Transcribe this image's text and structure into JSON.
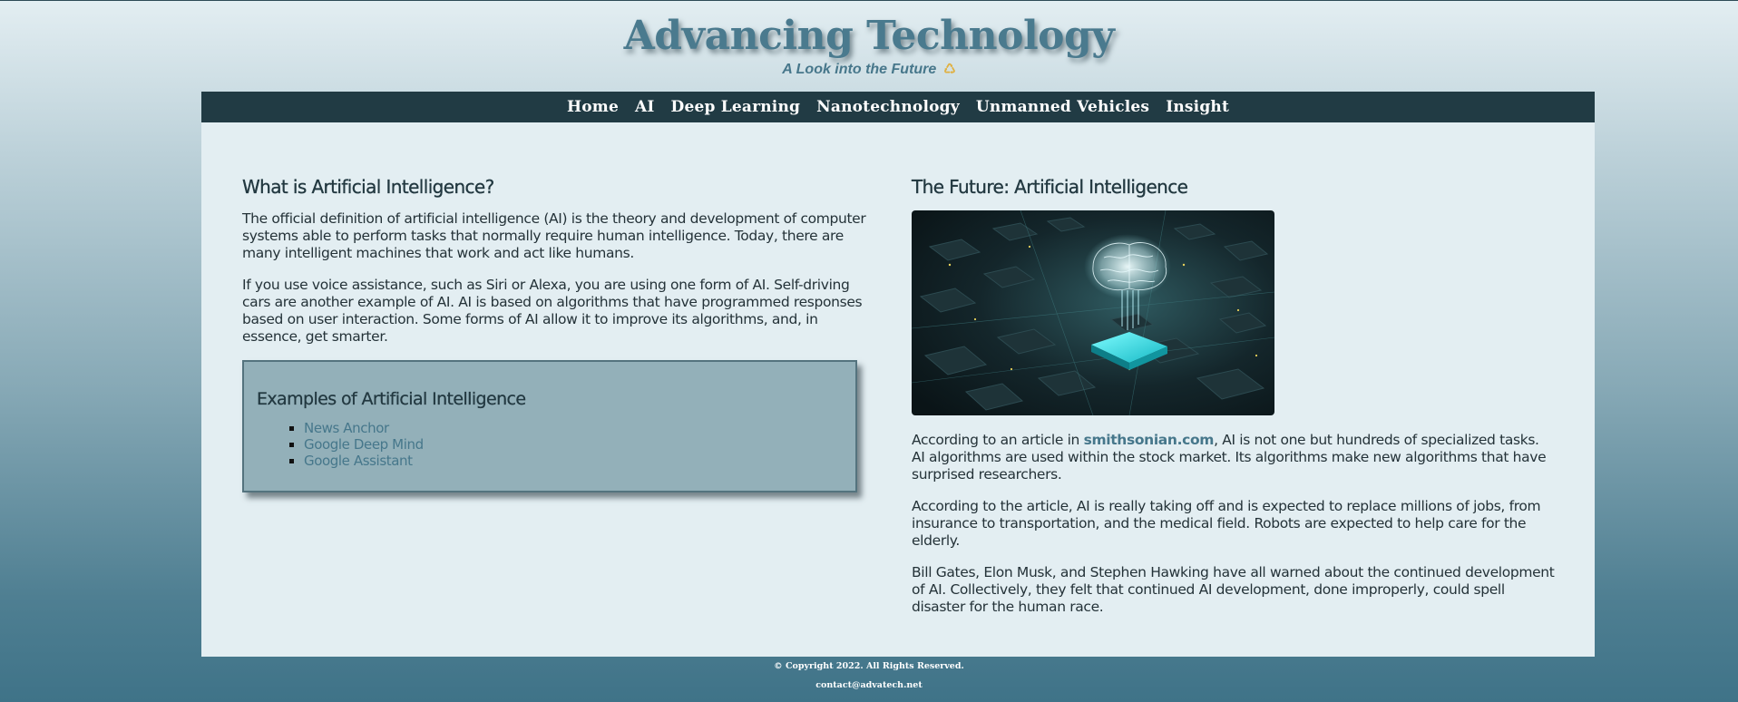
{
  "header": {
    "title": "Advancing Technology",
    "tagline": "A Look into the Future",
    "tagline_icon": "swirl-icon"
  },
  "nav": {
    "items": [
      {
        "label": "Home"
      },
      {
        "label": "AI"
      },
      {
        "label": "Deep Learning"
      },
      {
        "label": "Nanotechnology"
      },
      {
        "label": "Unmanned Vehicles"
      },
      {
        "label": "Insight"
      }
    ]
  },
  "left": {
    "heading": "What is Artificial Intelligence?",
    "paragraphs": [
      "The official definition of artificial intelligence (AI) is the theory and development of computer systems able to perform tasks that normally require human intelligence. Today, there are many intelligent machines that work and act like humans.",
      "If you use voice assistance, such as Siri or Alexa, you are using one form of AI. Self-driving cars are another example of AI. AI is based on algorithms that have programmed responses based on user interaction. Some forms of AI allow it to improve its algorithms, and, in essence, get smarter."
    ],
    "examples": {
      "heading": "Examples of Artificial Intelligence",
      "items": [
        {
          "label": "News Anchor"
        },
        {
          "label": "Google Deep Mind"
        },
        {
          "label": "Google Assistant"
        }
      ]
    }
  },
  "right": {
    "heading": "The Future: Artificial Intelligence",
    "image_name": "ai-brain-circuit-image",
    "p1_before": "According to an article in ",
    "p1_link": "smithsonian.com",
    "p1_after": ", AI is not one but hundreds of specialized tasks. AI algorithms are used within the stock market. Its algorithms make new algorithms that have surprised researchers.",
    "p2": "According to the article, AI is really taking off and is expected to replace millions of jobs, from insurance to transportation, and the medical field. Robots are expected to help care for the elderly.",
    "p3": "Bill Gates, Elon Musk, and Stephen Hawking have all warned about the continued development of AI. Collectively, they felt that continued AI development, done improperly, could spell disaster for the human race."
  },
  "footer": {
    "copyright": "© Copyright 2022. All Rights Reserved.",
    "contact": "contact@advatech.net"
  },
  "colors": {
    "nav_bg": "#213b44",
    "content_bg": "#e3eef2",
    "accent": "#46778b",
    "box_bg": "#93b0b9"
  }
}
